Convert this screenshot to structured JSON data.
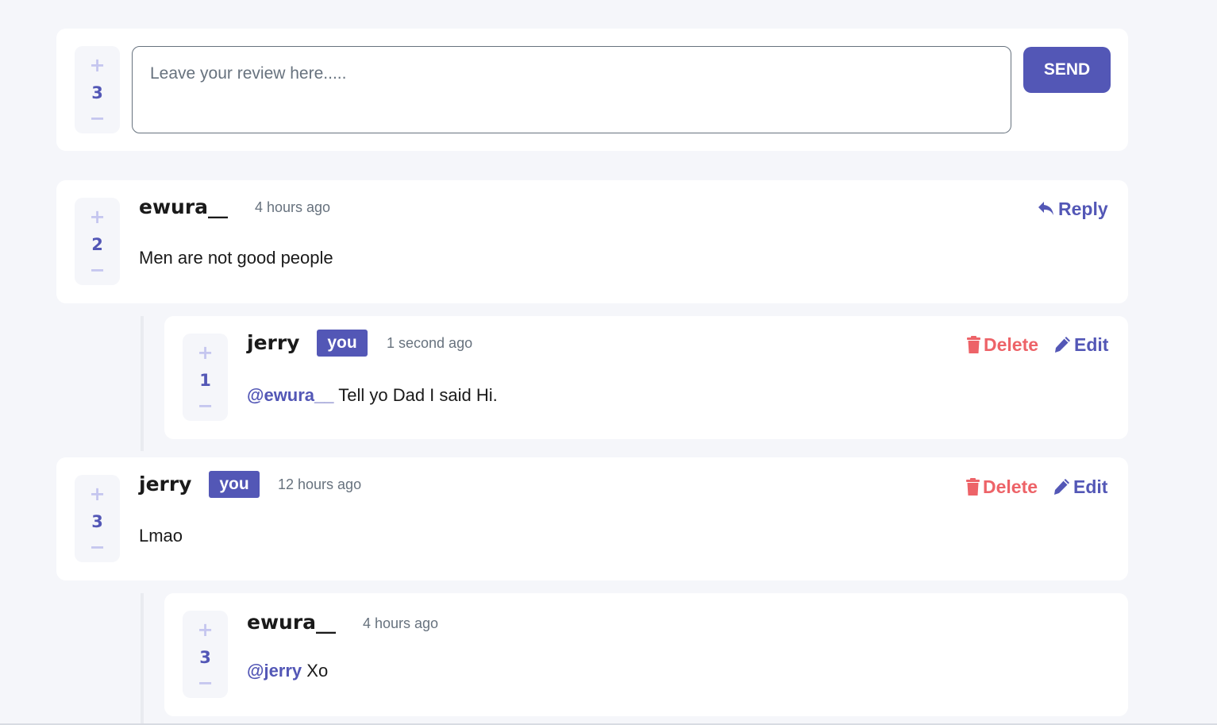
{
  "composer": {
    "vote_count": "3",
    "placeholder": "Leave your review here.....",
    "send_label": "SEND"
  },
  "comments": [
    {
      "username": "ewura__",
      "time": "4 hours ago",
      "content": "Men are not good people",
      "votes": "2",
      "reply_label": "Reply"
    },
    {
      "username": "jerry",
      "badge": "you",
      "time": "1 second ago",
      "mention": "@ewura__",
      "content": " Tell yo Dad I said Hi.",
      "votes": "1",
      "delete_label": "Delete",
      "edit_label": "Edit"
    },
    {
      "username": "jerry",
      "badge": "you",
      "time": "12 hours ago",
      "content": "Lmao",
      "votes": "3",
      "delete_label": "Delete",
      "edit_label": "Edit"
    },
    {
      "username": "ewura__",
      "time": "4 hours ago",
      "mention": "@jerry",
      "content": " Xo",
      "votes": "3"
    }
  ],
  "vote_controls": {
    "plus": "+",
    "minus": "−"
  },
  "colors": {
    "accent": "#5357b6",
    "delete": "#ed6368",
    "vote_light": "#c5c6ef",
    "background": "#f5f6fa",
    "text_muted": "#67727e"
  }
}
